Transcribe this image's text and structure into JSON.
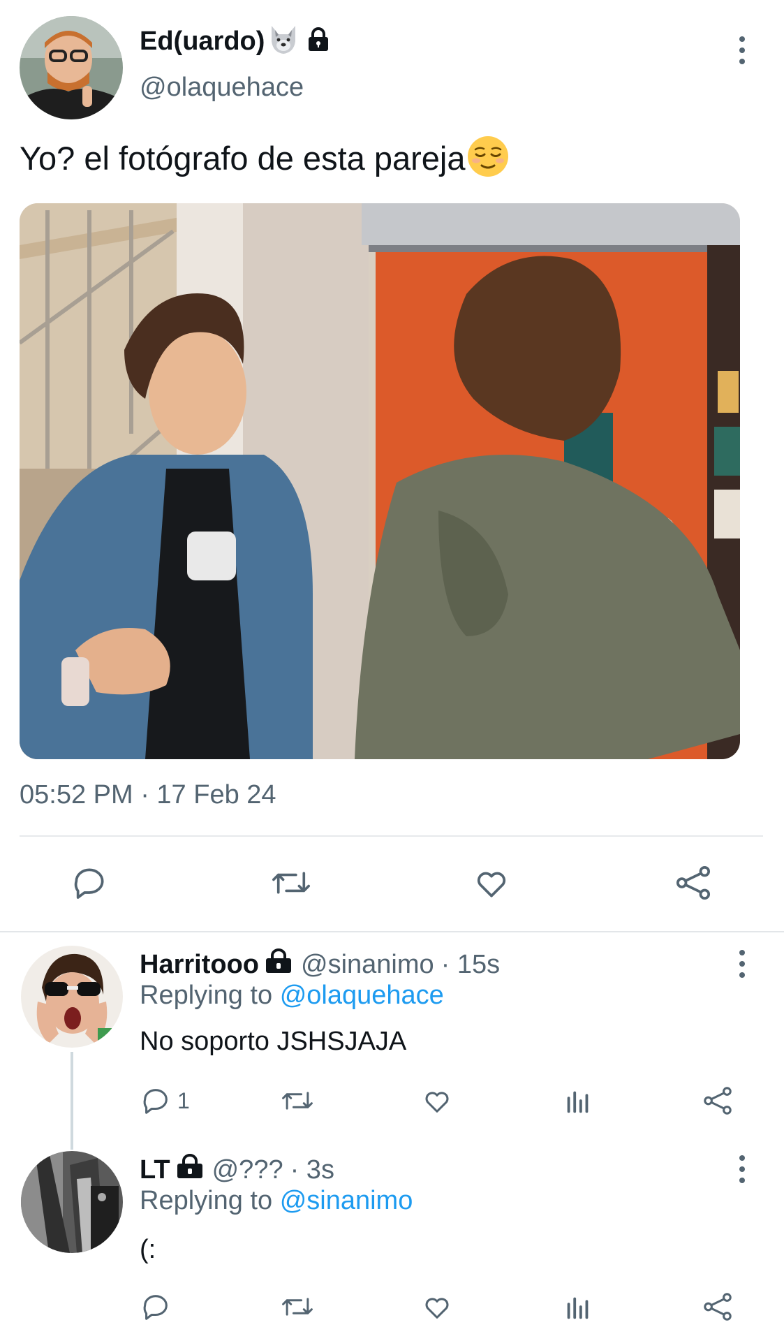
{
  "tweet": {
    "author_name": "Ed(uardo)",
    "author_emoji": "wolf-emoji",
    "author_handle": "@olaquehace",
    "text": "Yo? el fotógrafo de esta pareja",
    "text_emoji": "relieved-face-emoji",
    "timestamp": "05:52 PM · 17 Feb 24"
  },
  "replies": [
    {
      "author_name": "Harritooo",
      "author_handle": "@sinanimo",
      "time": "· 15s",
      "replying_prefix": "Replying to",
      "replying_to": "@olaquehace",
      "text": "No soporto JSHSJAJA",
      "reply_count": "1"
    },
    {
      "author_name": "LT",
      "author_handle": "@???",
      "time": "· 3s",
      "replying_prefix": "Replying to",
      "replying_to": "@sinanimo",
      "text": "(:"
    }
  ],
  "colors": {
    "accent": "#1d9bf0",
    "muted": "#536471",
    "text": "#0f1419"
  },
  "icons": [
    "reply-icon",
    "retweet-icon",
    "like-icon",
    "share-icon",
    "analytics-icon",
    "lock-icon",
    "more-icon"
  ]
}
